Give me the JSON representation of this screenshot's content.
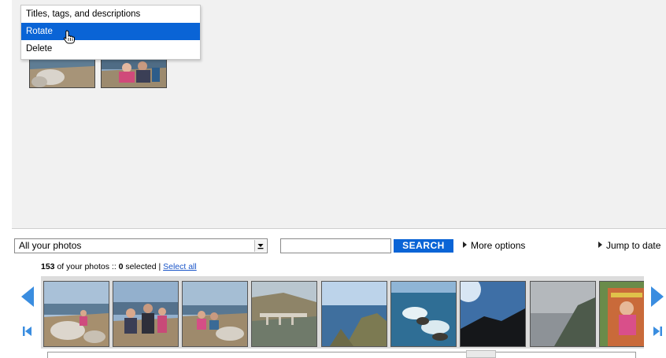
{
  "context_menu": {
    "items": [
      "Titles, tags, and descriptions",
      "Rotate",
      "Delete"
    ],
    "highlighted_index": 1
  },
  "toolbar": {
    "photo_set_select": "All your photos",
    "search_value": "",
    "search_label": "SEARCH",
    "more_options": "More options",
    "jump_to_date": "Jump to date"
  },
  "summary": {
    "count": "153",
    "of_your_photos": " of your photos :: ",
    "selected_count": "0",
    "selected_text": " selected | ",
    "select_all": "Select all"
  },
  "colors": {
    "accent": "#0a64d6",
    "nav_arrow": "#3a8de0",
    "link": "#1a55c8",
    "work_area": "#f1f1f1"
  },
  "icons": {
    "cursor": "hand-pointer-icon",
    "prev": "arrow-left-icon",
    "next": "arrow-right-icon",
    "first": "skip-to-first-icon",
    "last": "skip-to-last-icon",
    "dropdown": "chevron-down-icon"
  }
}
